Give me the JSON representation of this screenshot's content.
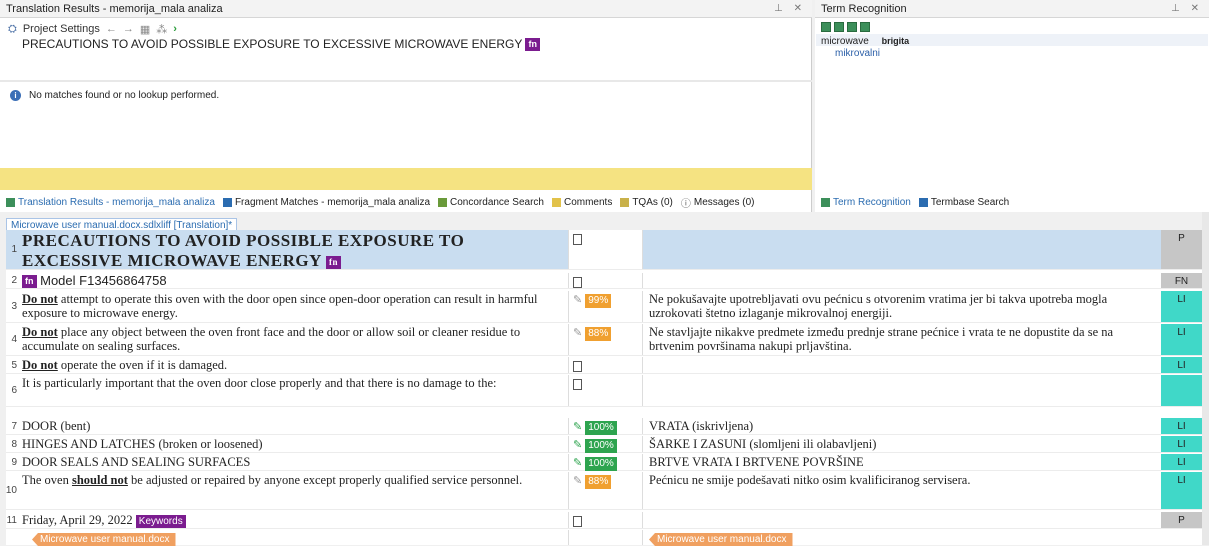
{
  "translation_results": {
    "title": "Translation Results - memorija_mala analiza",
    "controls": "ↀ ×",
    "toolbar": {
      "project_settings": "Project Settings"
    },
    "source": "PRECAUTIONS TO AVOID POSSIBLE EXPOSURE TO EXCESSIVE MICROWAVE ENERGY",
    "fn_tag": "fn",
    "info": "No matches found or no lookup performed."
  },
  "term_recognition": {
    "title": "Term Recognition",
    "source_term": "microwave",
    "termbase": "brigita",
    "target_term": "mikrovalni"
  },
  "bottom_tabs": [
    {
      "label": "Translation Results - memorija_mala analiza",
      "active": true
    },
    {
      "label": "Fragment Matches - memorija_mala analiza",
      "active": false
    },
    {
      "label": "Concordance Search",
      "active": false
    },
    {
      "label": "Comments",
      "active": false
    },
    {
      "label": "TQAs (0)",
      "active": false
    },
    {
      "label": "Messages (0)",
      "active": false
    }
  ],
  "term_tabs": [
    {
      "label": "Term Recognition",
      "active": true
    },
    {
      "label": "Termbase Search",
      "active": false
    }
  ],
  "editor": {
    "tab_label": "Microwave user manual.docx.sdlxliff [Translation]*",
    "rows": [
      {
        "num": "1",
        "source": "PRECAUTIONS TO AVOID POSSIBLE EXPOSURE TO EXCESSIVE MICROWAVE ENERGY",
        "match": "",
        "target": "",
        "code": "P"
      },
      {
        "num": "2",
        "source": "Model F13456864758",
        "match": "",
        "target": "",
        "code": "FN"
      },
      {
        "num": "3",
        "source_bold": "Do not",
        "source": " attempt to operate this oven with the door open since open-door operation can result in harmful exposure to microwave energy.",
        "match": "99%",
        "target": "Ne pokušavajte upotrebljavati ovu pećnicu s otvorenim vratima jer bi takva upotreba mogla uzrokovati štetno izlaganje mikrovalnoj energiji.",
        "code": "LI"
      },
      {
        "num": "4",
        "source_bold": "Do not",
        "source": " place any object between the oven front face and the door or allow soil or cleaner residue to accumulate on sealing surfaces.",
        "match": "88%",
        "target": "Ne stavljajte nikakve predmete između prednje strane pećnice i vrata te ne dopustite da se na brtvenim površinama nakupi prljavština.",
        "code": "LI"
      },
      {
        "num": "5",
        "source_bold": "Do not",
        "source": " operate the oven if it is damaged.",
        "match": "",
        "target": "",
        "code": "LI"
      },
      {
        "num": "6",
        "source": "It is particularly important that the oven door close properly and that there is no damage to the:",
        "match": "",
        "target": "",
        "code": ""
      },
      {
        "num": "7",
        "source": "DOOR (bent)",
        "match": "100%",
        "target": "VRATA (iskrivljena)",
        "code": "LI"
      },
      {
        "num": "8",
        "source": "HINGES AND LATCHES (broken or loosened)",
        "match": "100%",
        "target": "ŠARKE I ZASUNI (slomljeni ili olabavljeni)",
        "code": "LI"
      },
      {
        "num": "9",
        "source": "DOOR SEALS AND SEALING SURFACES",
        "match": "100%",
        "target": "BRTVE VRATA I BRTVENE POVRŠINE",
        "code": "LI"
      },
      {
        "num": "10",
        "source_pre": "The oven ",
        "source_bold": "should not",
        "source": " be adjusted or repaired by anyone except properly qualified service personnel.",
        "match": "88%",
        "target": "Pećnicu ne smije podešavati nitko osim kvalificiranog servisera.",
        "code": "LI"
      },
      {
        "num": "11",
        "source": "Friday, April 29, 2022",
        "tag": "Keywords",
        "match": "",
        "target": "",
        "code": "P"
      }
    ],
    "end_tag_label": "Microwave user manual.docx"
  },
  "colors": {
    "fn_tag": "#7b1c8f",
    "fuzzy": "#f0a030",
    "exact": "#2ea44f",
    "code_li": "#40d8c8",
    "header_row": "#c9ddf0"
  }
}
